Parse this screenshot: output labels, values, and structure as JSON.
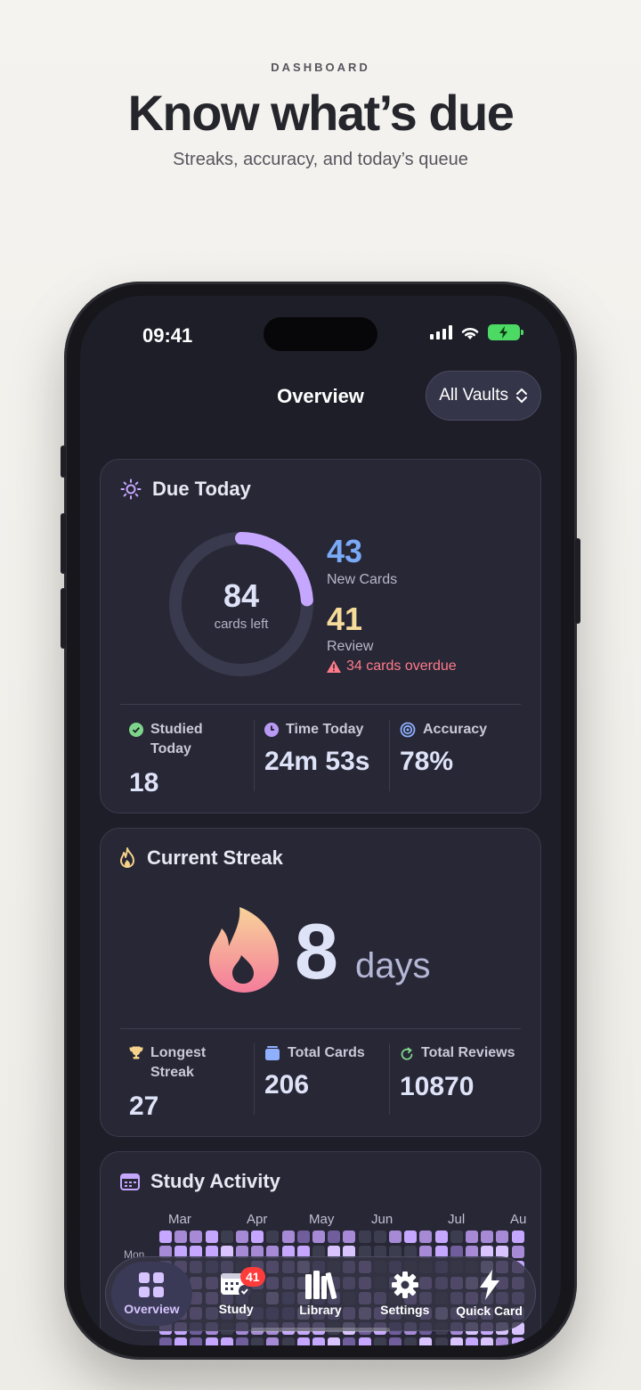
{
  "marketing": {
    "eyebrow": "DASHBOARD",
    "title": "Know what’s due",
    "subtitle": "Streaks, accuracy, and today’s queue"
  },
  "status_bar": {
    "time": "09:41"
  },
  "nav": {
    "title": "Overview",
    "vault_selector": "All Vaults"
  },
  "due_today": {
    "title": "Due Today",
    "cards_left": "84",
    "cards_left_label": "cards left",
    "progress_fraction": 0.24,
    "new_cards": "43",
    "new_cards_label": "New Cards",
    "review": "41",
    "review_label": "Review",
    "overdue": "34 cards overdue",
    "stats": [
      {
        "icon": "check-circle-icon",
        "label": "Studied Today",
        "value": "18"
      },
      {
        "icon": "clock-icon",
        "label": "Time Today",
        "value": "24m 53s"
      },
      {
        "icon": "target-icon",
        "label": "Accuracy",
        "value": "78%"
      }
    ]
  },
  "streak": {
    "title": "Current Streak",
    "value": "8",
    "unit": "days",
    "stats": [
      {
        "icon": "trophy-icon",
        "label": "Longest Streak",
        "value": "27"
      },
      {
        "icon": "stack-icon",
        "label": "Total Cards",
        "value": "206"
      },
      {
        "icon": "refresh-icon",
        "label": "Total Reviews",
        "value": "10870"
      }
    ]
  },
  "activity": {
    "title": "Study Activity",
    "months": [
      "Mar",
      "Apr",
      "May",
      "Jun",
      "Jul",
      "Au"
    ],
    "day_label": "Mon"
  },
  "tabbar": {
    "items": [
      {
        "label": "Overview",
        "icon": "grid-icon"
      },
      {
        "label": "Study",
        "icon": "calendar-check-icon",
        "badge": "41"
      },
      {
        "label": "Library",
        "icon": "books-icon"
      },
      {
        "label": "Settings",
        "icon": "gear-icon"
      },
      {
        "label": "Quick Card",
        "icon": "bolt-icon"
      }
    ]
  },
  "colors": {
    "accent_purple": "#c6a7ff",
    "new_blue": "#7aaaf6",
    "review_yellow": "#f6dc9a",
    "overdue_red": "#ff7b8a",
    "check_green": "#7ed48a"
  }
}
